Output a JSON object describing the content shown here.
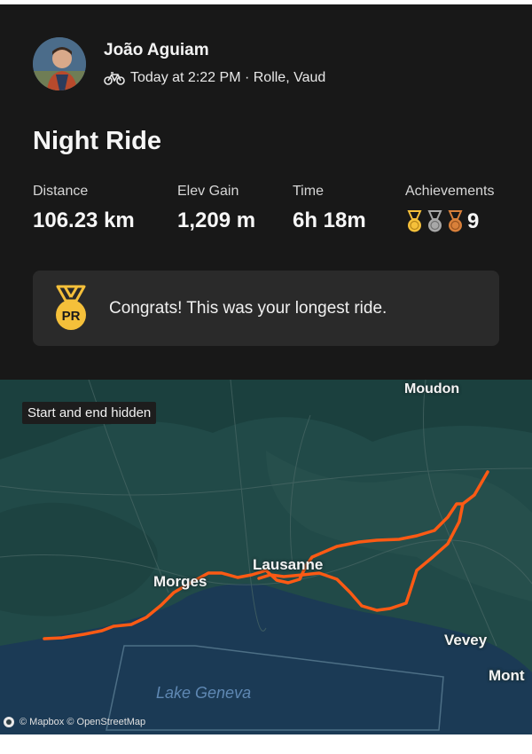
{
  "athlete": {
    "name": "João Aguiam"
  },
  "activity": {
    "meta": "Today at 2:22 PM · Rolle, Vaud",
    "title": "Night Ride",
    "stats": [
      {
        "label": "Distance",
        "value": "106.23 km"
      },
      {
        "label": "Elev Gain",
        "value": "1,209 m"
      },
      {
        "label": "Time",
        "value": "6h 18m"
      }
    ],
    "achievements": {
      "label": "Achievements",
      "count": "9",
      "medals": [
        "gold-medal-icon",
        "silver-medal-icon",
        "bronze-medal-icon"
      ]
    }
  },
  "pr_banner": {
    "icon": "pr-medal-icon",
    "badge": "PR",
    "text": "Congrats! This was your longest ride."
  },
  "map": {
    "privacy_tag": "Start and end hidden",
    "places": [
      "Moudon",
      "Lausanne",
      "Morges",
      "Vevey",
      "Mont"
    ],
    "lake": "Lake Geneva",
    "attribution": "© Mapbox © OpenStreetMap",
    "route_color": "#fc5a14"
  },
  "colors": {
    "background": "#181818",
    "card": "#2a2a2a",
    "gold": "#f5c03a",
    "silver": "#a8a8a8",
    "bronze": "#d9803a"
  }
}
